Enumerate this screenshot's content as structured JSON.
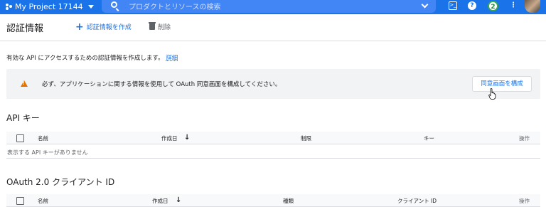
{
  "topbar": {
    "project_name": "My Project 17144",
    "search_placeholder": "プロダクトとリソースの検索",
    "notification_count": "2",
    "colors": {
      "bar": "#1a73e8",
      "search": "#4285f4"
    }
  },
  "header": {
    "title": "認証情報",
    "create_label": "認証情報を作成",
    "delete_label": "削除"
  },
  "intro": {
    "text": "有効な API にアクセスするための認証情報を作成します。",
    "link": "詳細"
  },
  "banner": {
    "text": "必ず、アプリケーションに関する情報を使用して OAuth 同意画面を構成してください。",
    "button": "同意画面を構成",
    "icon": "warning-icon"
  },
  "api_keys": {
    "title": "API キー",
    "columns": [
      "名前",
      "作成日",
      "制限",
      "キー",
      "操作"
    ],
    "empty": "表示する API キーがありません"
  },
  "oauth": {
    "title": "OAuth 2.0 クライアント ID",
    "columns": [
      "名前",
      "作成日",
      "種類",
      "クライアント ID",
      "操作"
    ]
  }
}
